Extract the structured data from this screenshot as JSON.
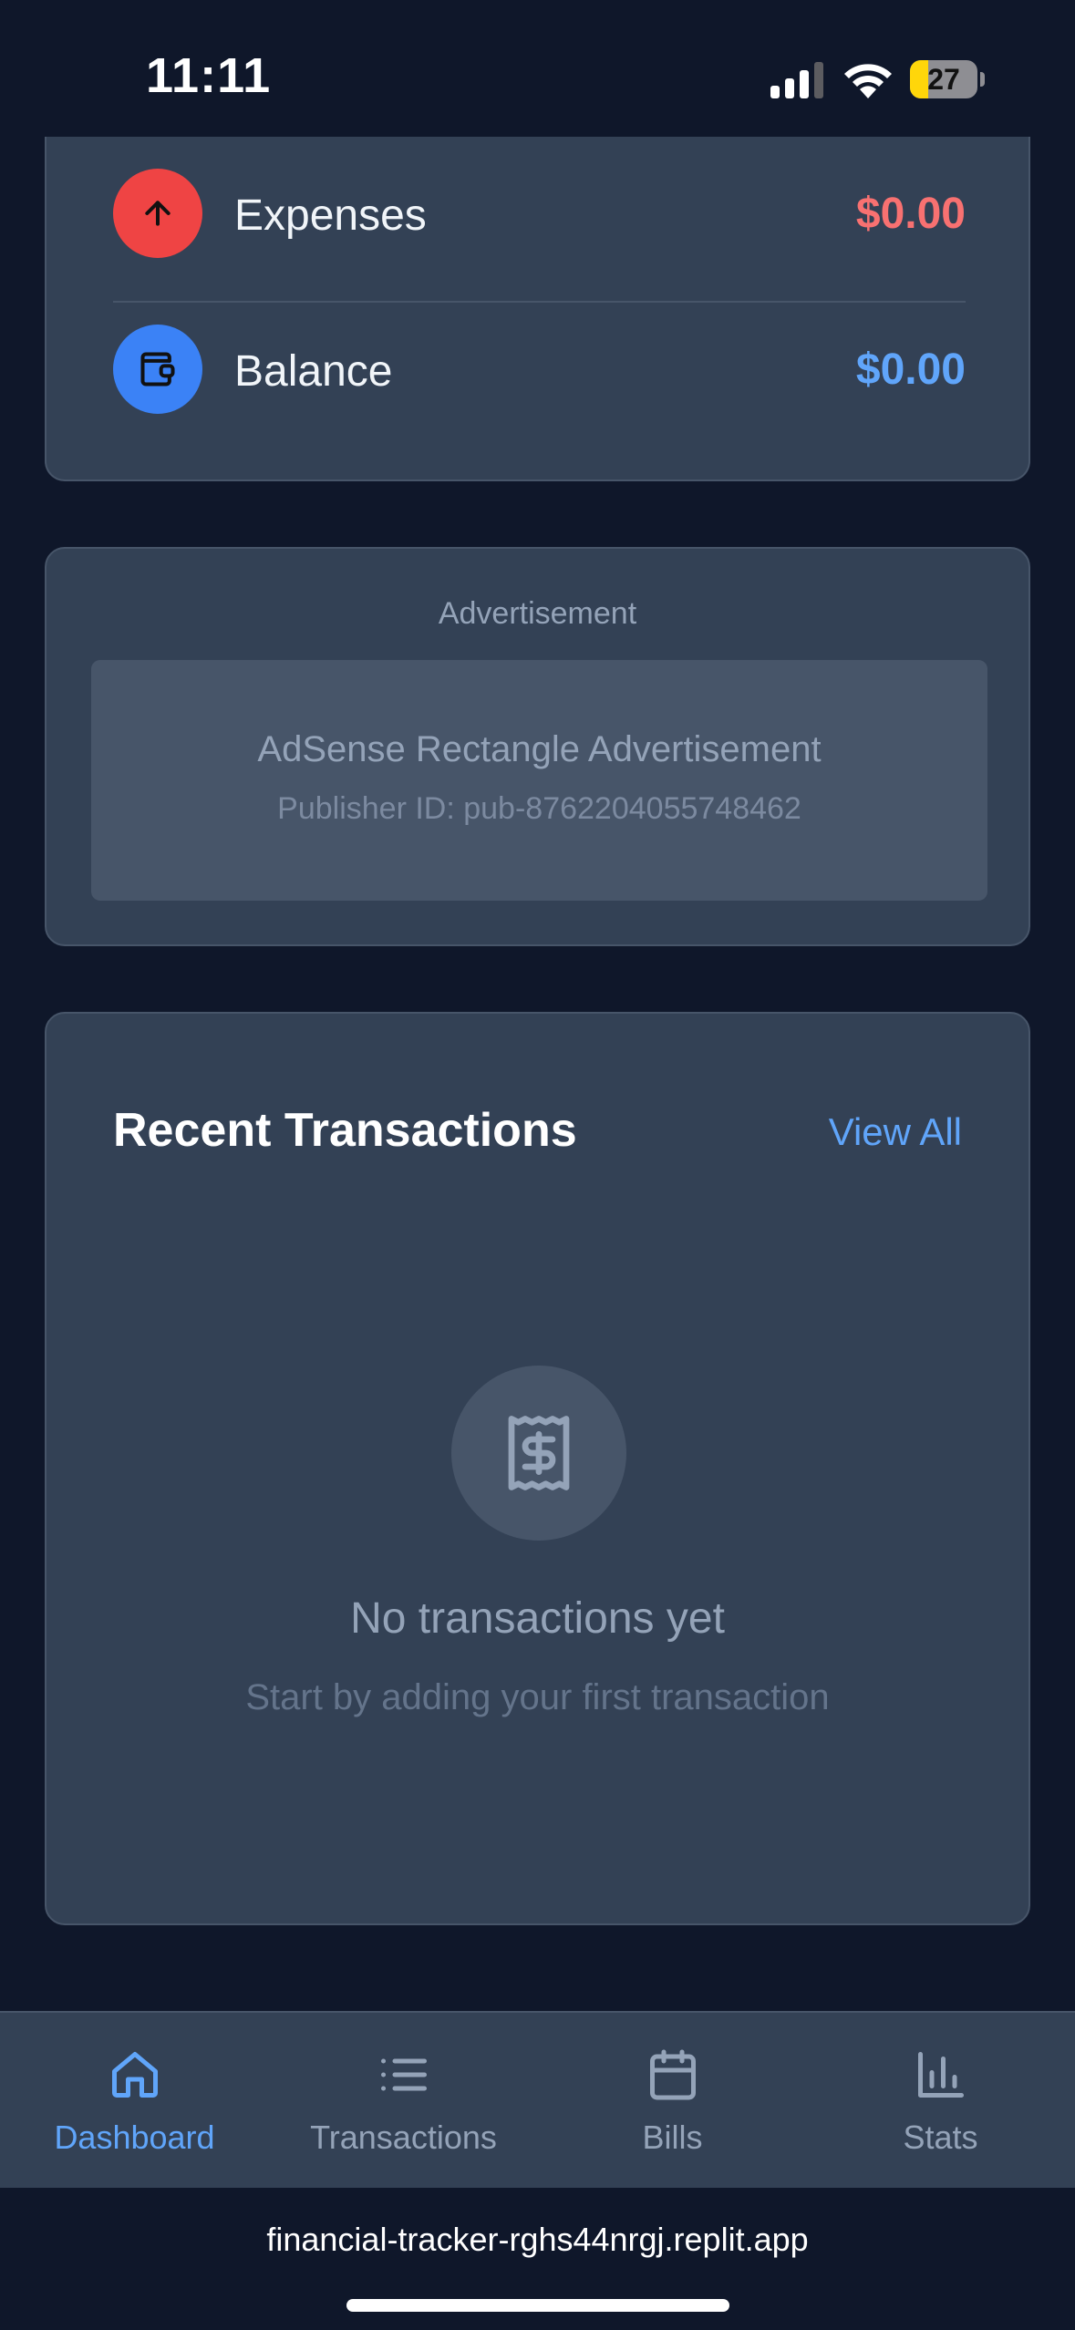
{
  "status_bar": {
    "time": "11:11",
    "battery_level": "27",
    "battery_fraction": 0.27,
    "icons": [
      "cellular-signal-icon",
      "wifi-icon",
      "battery-icon"
    ]
  },
  "summary": {
    "rows": [
      {
        "label": "Expenses",
        "amount": "$0.00",
        "icon": "arrow-up-icon",
        "icon_color": "#ef4444",
        "amount_color": "#f87171"
      },
      {
        "label": "Balance",
        "amount": "$0.00",
        "icon": "wallet-icon",
        "icon_color": "#3b82f6",
        "amount_color": "#60a5fa"
      }
    ]
  },
  "ad": {
    "label": "Advertisement",
    "title": "AdSense Rectangle Advertisement",
    "publisher": "Publisher ID: pub-8762204055748462"
  },
  "recent": {
    "title": "Recent Transactions",
    "view_all": "View All",
    "empty_icon": "receipt-dollar-icon",
    "empty_title": "No transactions yet",
    "empty_subtitle": "Start by adding your first transaction"
  },
  "nav": {
    "items": [
      {
        "label": "Dashboard",
        "icon": "home-icon",
        "active": true
      },
      {
        "label": "Transactions",
        "icon": "list-icon",
        "active": false
      },
      {
        "label": "Bills",
        "icon": "calendar-icon",
        "active": false
      },
      {
        "label": "Stats",
        "icon": "bar-chart-icon",
        "active": false
      }
    ],
    "active_color": "#60a5fa",
    "inactive_color": "#94a3b8"
  },
  "browser": {
    "url": "financial-tracker-rghs44nrgj.replit.app"
  }
}
